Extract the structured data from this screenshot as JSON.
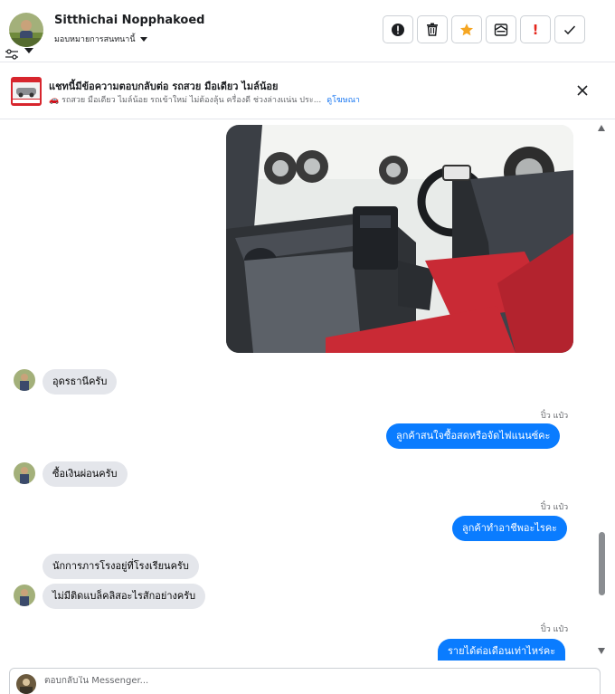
{
  "header": {
    "user_name": "Sitthichai Nopphakoed",
    "assign_label": "มอบหมายการสนทนานี้",
    "actions": [
      {
        "icon": "alert-circle-icon",
        "label": "!"
      },
      {
        "icon": "trash-icon",
        "label": ""
      },
      {
        "icon": "star-icon",
        "label": "★"
      },
      {
        "icon": "mark-unread-icon",
        "label": ""
      },
      {
        "icon": "spam-icon",
        "label": "!"
      },
      {
        "icon": "check-icon",
        "label": "✓"
      }
    ]
  },
  "ad_banner": {
    "title": "แชทนี้มีข้อความตอบกลับต่อ รถสวย มือเดียว ไมล์น้อย",
    "subtitle": "🚗 รถสวย มือเดียว ไมล์น้อย รถเข้าใหม่ ไม่ต้องลุ้น ครื่องดี ช่วงล่างแน่น ประ...",
    "link": "ดูโฆษณา"
  },
  "messages": [
    {
      "dir": "in",
      "text": "อุดรธานีครับ"
    },
    {
      "dir": "out",
      "sender": "ปิ๋ว แป๋ว",
      "text": "ลูกค้าสนใจซื้อสดหรือจัดไฟแนนซ์คะ"
    },
    {
      "dir": "in",
      "text": "ซื้อเงินผ่อนครับ"
    },
    {
      "dir": "out",
      "sender": "ปิ๋ว แป๋ว",
      "text": "ลูกค้าทำอาชีพอะไรคะ"
    },
    {
      "dir": "in",
      "text": "นักการภารโรงอยู่ที่โรงเรียนครับ"
    },
    {
      "dir": "in",
      "text": "ไม่มีติดแบล็คลิสอะไรสักอย่างครับ"
    },
    {
      "dir": "out",
      "sender": "ปิ๋ว แป๋ว",
      "text": "รายได้ต่อเดือนเท่าไหร่คะ"
    }
  ],
  "composer": {
    "placeholder": "ตอบกลับใน Messenger..."
  },
  "colors": {
    "outgoing_bubble": "#0a7cff",
    "incoming_bubble": "#e4e6eb",
    "star": "#f5a623",
    "alert": "#e4261c"
  }
}
